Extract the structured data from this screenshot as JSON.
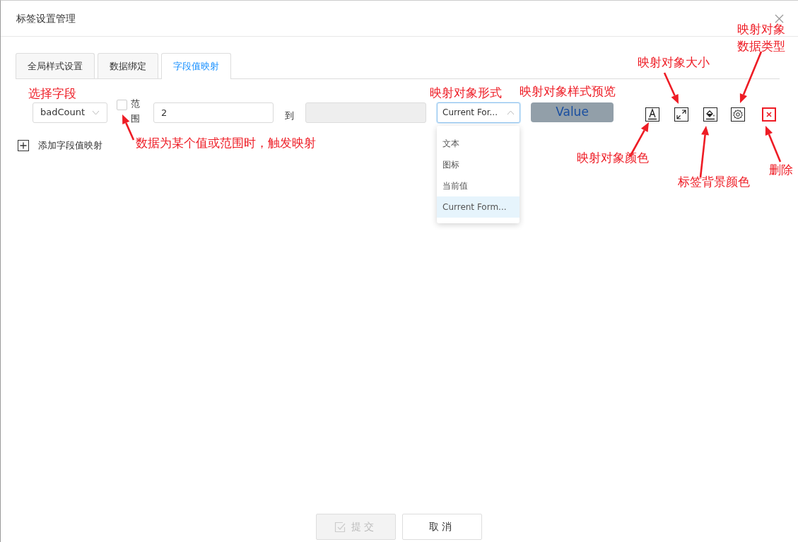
{
  "dialog": {
    "title": "标签设置管理"
  },
  "tabs": [
    {
      "label": "全局样式设置",
      "selected": false
    },
    {
      "label": "数据绑定",
      "selected": false
    },
    {
      "label": "字段值映射",
      "selected": true
    }
  ],
  "mapping_row": {
    "field_select": {
      "value": "badCount"
    },
    "range_checkbox": {
      "label": "范围",
      "checked": false
    },
    "from_input": {
      "value": "2"
    },
    "to_label": "到",
    "to_input": {
      "disabled": true
    },
    "form_select": {
      "value": "Current For...",
      "expanded": true,
      "options": [
        {
          "label": "文本",
          "selected": false
        },
        {
          "label": "图标",
          "selected": false
        },
        {
          "label": "当前值",
          "selected": false
        },
        {
          "label": "Current Form...",
          "selected": true
        }
      ]
    },
    "preview_button": {
      "label": "Value"
    }
  },
  "add_link": {
    "label": "添加字段值映射"
  },
  "footer": {
    "buttons": [
      {
        "label": "提交",
        "disabled": true
      },
      {
        "label": "取消",
        "disabled": false
      }
    ]
  },
  "annotations": [
    {
      "text": "选择字段"
    },
    {
      "text": "数据为某个值或范围时，触发映射"
    },
    {
      "text": "映射对象形式"
    },
    {
      "text": "映射对象样式预览"
    },
    {
      "text": "映射对象大小"
    },
    {
      "text": "映射对象数据类型"
    },
    {
      "text": "映射对象颜色"
    },
    {
      "text": "标签背景颜色"
    },
    {
      "text": "删除"
    }
  ]
}
